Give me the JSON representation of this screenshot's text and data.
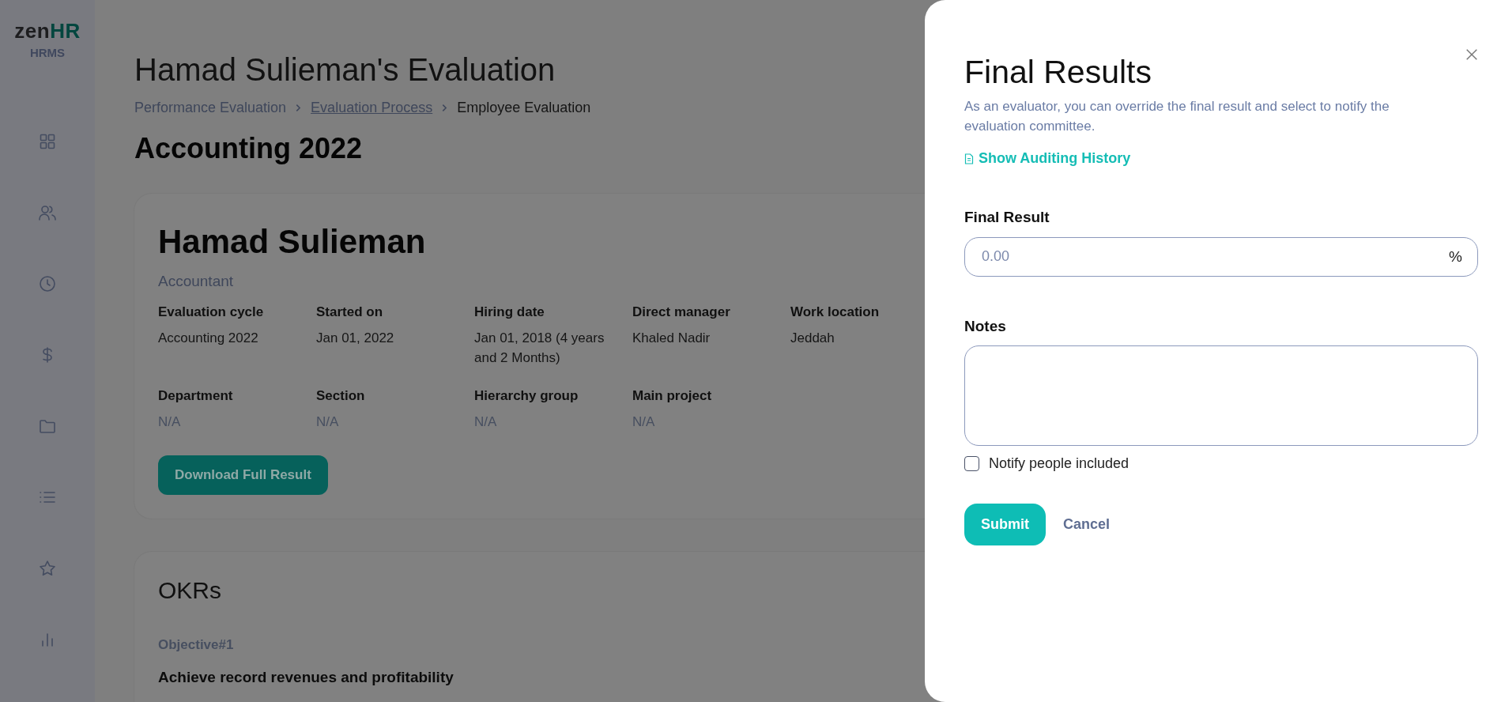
{
  "sidebar": {
    "logo": {
      "part1": "zen",
      "part2": "HR"
    },
    "product": "HRMS",
    "items": [
      {
        "kind": "grid"
      },
      {
        "kind": "users"
      },
      {
        "kind": "clock"
      },
      {
        "kind": "dollar"
      },
      {
        "kind": "folder"
      },
      {
        "kind": "list"
      },
      {
        "kind": "star"
      },
      {
        "kind": "chart"
      }
    ]
  },
  "page": {
    "title": "Hamad Sulieman's Evaluation",
    "breadcrumb": [
      {
        "label": "Performance Evaluation",
        "link": false
      },
      {
        "label": "Evaluation Process",
        "link": true
      },
      {
        "label": "Employee Evaluation",
        "link": false
      }
    ],
    "cycle_heading": "Accounting 2022"
  },
  "employee_card": {
    "name": "Hamad Sulieman",
    "job_title": "Accountant",
    "fields": [
      {
        "label": "Evaluation cycle",
        "value": "Accounting 2022",
        "empty": false
      },
      {
        "label": "Started on",
        "value": "Jan 01, 2022",
        "empty": false
      },
      {
        "label": "Hiring date",
        "value": "Jan 01, 2018 (4 years and 2 Months)",
        "empty": false
      },
      {
        "label": "Direct manager",
        "value": "Khaled Nadir",
        "empty": false
      },
      {
        "label": "Work location",
        "value": "Jeddah",
        "empty": false
      },
      {
        "label": "Department",
        "value": "N/A",
        "empty": true
      },
      {
        "label": "Section",
        "value": "N/A",
        "empty": true
      },
      {
        "label": "Hierarchy group",
        "value": "N/A",
        "empty": true
      },
      {
        "label": "Main project",
        "value": "N/A",
        "empty": true
      }
    ],
    "button": "Download Full Result"
  },
  "okrs": {
    "title": "OKRs",
    "objective_label": "Objective#1",
    "objective": "Achieve record revenues and profitability"
  },
  "drawer": {
    "title": "Final Results",
    "description": "As an evaluator, you can override the final result and select to notify the evaluation committee.",
    "history_link": "Show Auditing History",
    "final_result": {
      "label": "Final Result",
      "placeholder": "0.00",
      "suffix": "%"
    },
    "notes": {
      "label": "Notes"
    },
    "notify": {
      "label": "Notify people included",
      "checked": false
    },
    "buttons": {
      "submit": "Submit",
      "cancel": "Cancel"
    }
  }
}
